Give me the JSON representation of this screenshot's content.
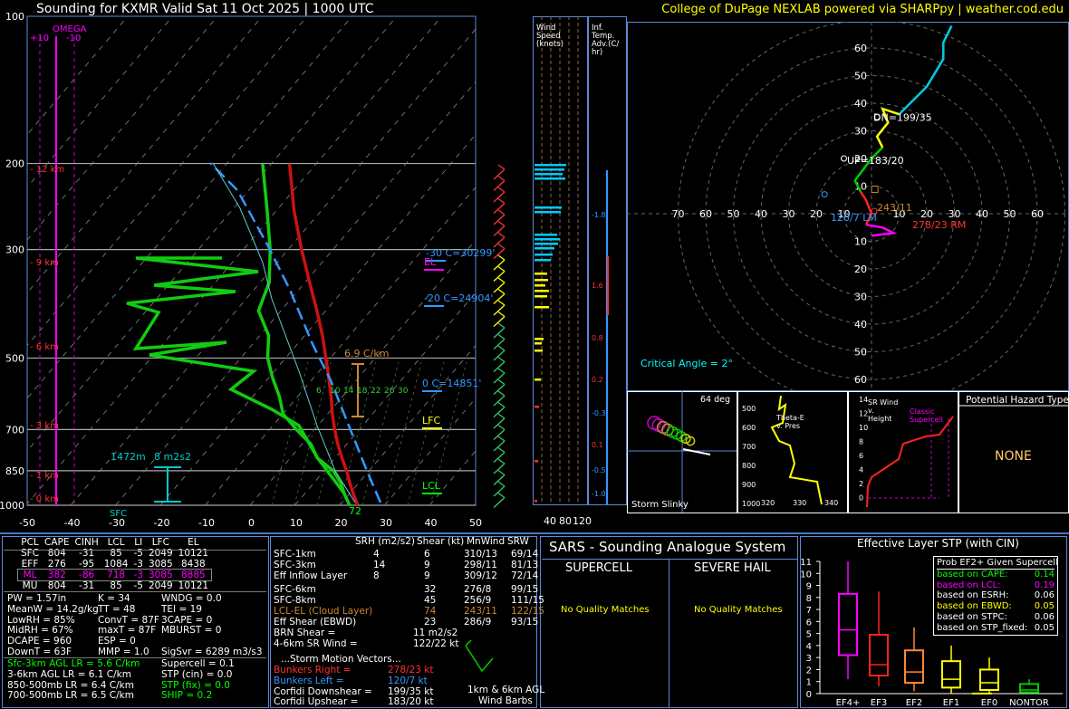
{
  "header": {
    "title": "Sounding for KXMR Valid  Sat 11 Oct 2025 | 1000 UTC",
    "credit": "College of DuPage NEXLAB powered via SHARPpy | weather.cod.edu"
  },
  "skewt": {
    "omega_label": "OMEGA",
    "omega_ticks": [
      "+10",
      "-10"
    ],
    "pressure_ticks": [
      "100",
      "200",
      "300",
      "500",
      "700",
      "850",
      "1000"
    ],
    "temp_ticks": [
      "-50",
      "-40",
      "-30",
      "-20",
      "-10",
      "0",
      "10",
      "20",
      "30",
      "40",
      "50"
    ],
    "height_labels": [
      "12 km",
      "9 km",
      "6 km",
      "3 km",
      "1 km",
      "0 km"
    ],
    "levels": [
      {
        "label": "-30 C=30299'",
        "kind": "iso"
      },
      {
        "label": "EL",
        "kind": "el"
      },
      {
        "label": "-20 C=24904'",
        "kind": "iso"
      },
      {
        "label": "0 C=14851'",
        "kind": "iso"
      },
      {
        "label": "LFC",
        "kind": "lfc"
      },
      {
        "label": "LCL",
        "kind": "lcl"
      }
    ],
    "lapse_label": "6.9 C/km",
    "eff_inflow_label": "1472m",
    "eff_srh_label": "8 m2s2",
    "sfc_label": "SFC",
    "dewpoint_sfc": "72",
    "mixing_ratio_labels": [
      "6",
      "10",
      "14",
      "18",
      "22",
      "26",
      "30"
    ]
  },
  "wind_speed_panel": {
    "title": "Wind Speed (knots)",
    "ticks": [
      "40",
      "80",
      "120"
    ]
  },
  "inferred_adv_panel": {
    "title": "Inf. Temp. Adv.(C/ hr)",
    "labels": [
      "-1.8",
      "1.6",
      "0.8",
      "0.2",
      "-0.3",
      "0.1",
      "-0.5",
      "-1.0"
    ]
  },
  "hodograph": {
    "rings": [
      "10",
      "20",
      "30",
      "40",
      "50",
      "60"
    ],
    "x_ticks": [
      "70",
      "60",
      "50",
      "40",
      "30",
      "20",
      "10",
      "10",
      "20",
      "30",
      "40",
      "50",
      "60"
    ],
    "y_ticks": [
      "60",
      "50",
      "40",
      "30",
      "20",
      "10",
      "10",
      "20",
      "30",
      "40",
      "50",
      "60"
    ],
    "dn_label": "DN=199/35",
    "up_label": "UP=183/20",
    "mean_label": "243/11",
    "lm_label": "120/7 LM",
    "rm_label": "278/23 RM",
    "critical_angle": "Critical Angle = 2°"
  },
  "small_panels": {
    "storm_slinky": {
      "title": "Storm Slinky",
      "deg": "64 deg"
    },
    "theta_e": {
      "title": "Theta-E v. Pres",
      "y_ticks": [
        "500",
        "600",
        "700",
        "800",
        "900",
        "1000"
      ],
      "x_ticks": [
        "320",
        "330",
        "340"
      ]
    },
    "sr_wind": {
      "title": "SR Wind v. Height",
      "y_ticks": [
        "14",
        "12",
        "10",
        "8",
        "6",
        "4",
        "2",
        "0"
      ],
      "label": "Classic Supercell"
    },
    "hazard": {
      "title": "Potential Hazard Type",
      "value": "NONE"
    }
  },
  "parcels": {
    "headers": [
      "PCL",
      "CAPE",
      "CINH",
      "LCL",
      "LI",
      "LFC",
      "EL"
    ],
    "rows": [
      [
        "SFC",
        "804",
        "-31",
        "85",
        "-5",
        "2049",
        "10121"
      ],
      [
        "EFF",
        "276",
        "-95",
        "1084",
        "-3",
        "3085",
        "8438"
      ],
      [
        "ML",
        "382",
        "-86",
        "718",
        "-3",
        "3085",
        "8885"
      ],
      [
        "MU",
        "804",
        "-31",
        "85",
        "-5",
        "2049",
        "10121"
      ]
    ]
  },
  "thermo": {
    "col1": [
      "PW = 1.57in",
      "MeanW = 14.2g/kg",
      "LowRH = 85%",
      "MidRH = 67%",
      "DCAPE = 960",
      "DownT = 63F"
    ],
    "col2": [
      "K = 34",
      "TT = 48",
      "ConvT = 87F",
      "maxT = 87F",
      "ESP = 0",
      "MMP = 1.0"
    ],
    "col3": [
      "WNDG = 0.0",
      "TEI = 19",
      "3CAPE = 0",
      "MBURST = 0",
      "",
      "SigSvr = 6289 m3/s3"
    ]
  },
  "lapse_rates": [
    {
      "text": "Sfc-3km AGL LR = 5.6 C/km",
      "color": "#00ff00"
    },
    {
      "text": "3-6km AGL LR = 6.1 C/km",
      "color": "#ffffff"
    },
    {
      "text": "850-500mb LR = 6.4 C/km",
      "color": "#ffffff"
    },
    {
      "text": "700-500mb LR = 6.5 C/km",
      "color": "#ffffff"
    }
  ],
  "indices": [
    {
      "text": "Supercell = 0.1",
      "color": "#ffffff"
    },
    {
      "text": "STP (cin) = 0.0",
      "color": "#ffffff"
    },
    {
      "text": "STP (fix) = 0.0",
      "color": "#00ff00"
    },
    {
      "text": "SHIP = 0.2",
      "color": "#00ff00"
    }
  ],
  "kinematics": {
    "headers": [
      "SRH (m2/s2)",
      "Shear (kt)",
      "MnWind",
      "SRW"
    ],
    "rows1": [
      [
        "SFC-1km",
        "4",
        "6",
        "310/13",
        "69/14"
      ],
      [
        "SFC-3km",
        "14",
        "9",
        "298/11",
        "81/13"
      ],
      [
        "Eff Inflow Layer",
        "8",
        "9",
        "309/12",
        "72/14"
      ]
    ],
    "rows2": [
      [
        "SFC-6km",
        "",
        "32",
        "276/8",
        "99/15"
      ],
      [
        "SFC-8km",
        "",
        "45",
        "256/9",
        "111/15"
      ],
      [
        "LCL-EL (Cloud Layer)",
        "",
        "74",
        "243/11",
        "122/15"
      ],
      [
        "Eff Shear (EBWD)",
        "",
        "23",
        "286/9",
        "93/15"
      ]
    ],
    "brn_shear": "BRN Shear =",
    "brn_value": "11 m2/s2",
    "sr_wind_46": "4-6km SR Wind =",
    "sr_wind_46_value": "122/22 kt",
    "storm_motion_title": "...Storm Motion Vectors...",
    "vectors": [
      {
        "label": "Bunkers Right =",
        "value": "278/23 kt",
        "color": "#ff3030"
      },
      {
        "label": "Bunkers Left =",
        "value": "120/7 kt",
        "color": "#3399ff"
      },
      {
        "label": "Corfidi Downshear =",
        "value": "199/35 kt",
        "color": "#ffffff"
      },
      {
        "label": "Corfidi Upshear =",
        "value": "183/20 kt",
        "color": "#ffffff"
      }
    ],
    "barbs_label1": "1km & 6km AGL",
    "barbs_label2": "Wind Barbs"
  },
  "sars": {
    "title": "SARS - Sounding Analogue System",
    "supercell_title": "SUPERCELL",
    "hail_title": "SEVERE HAIL",
    "supercell_result": "No Quality Matches",
    "hail_result": "No Quality Matches"
  },
  "stp": {
    "title": "Effective Layer STP (with CIN)",
    "y_ticks": [
      "11",
      "10",
      "9",
      "8",
      "7",
      "6",
      "5",
      "4",
      "3",
      "2",
      "1",
      "0"
    ],
    "x_labels": [
      "EF4+",
      "EF3",
      "EF2",
      "EF1",
      "EF0",
      "NONTOR"
    ],
    "legend_title": "Prob EF2+ Given Supercell",
    "legend": [
      {
        "label": "based on CAPE:",
        "value": "0.14",
        "color": "#00ff00"
      },
      {
        "label": "based on LCL:",
        "value": "0.19",
        "color": "#ff00ff"
      },
      {
        "label": "based on ESRH:",
        "value": "0.06",
        "color": "#ffffff"
      },
      {
        "label": "based on EBWD:",
        "value": "0.05",
        "color": "#ffff00"
      },
      {
        "label": "based on STPC:",
        "value": "0.06",
        "color": "#ffffff"
      },
      {
        "label": "based on STP_fixed:",
        "value": "0.05",
        "color": "#ffffff"
      }
    ]
  },
  "chart_data": {
    "type": "line",
    "title": "Sounding for KXMR Valid  Sat 11 Oct 2025 | 1000 UTC",
    "xlabel": "",
    "ylabel": "",
    "xlim": [
      -50,
      50
    ],
    "ylim": [
      1000,
      100
    ],
    "y_scale": "log",
    "series": [
      {
        "name": "",
        "points": [
          [
            1000,
            24
          ],
          [
            950,
            21
          ],
          [
            900,
            18
          ],
          [
            850,
            15
          ],
          [
            800,
            11.5
          ],
          [
            750,
            8
          ],
          [
            700,
            4.5
          ],
          [
            650,
            1
          ],
          [
            600,
            -2.5
          ],
          [
            550,
            -6.5
          ],
          [
            500,
            -11
          ],
          [
            450,
            -16
          ],
          [
            400,
            -22
          ],
          [
            350,
            -29
          ],
          [
            300,
            -37
          ],
          [
            250,
            -46
          ],
          [
            200,
            -56
          ]
        ]
      },
      {
        "name": "",
        "points": [
          [
            1000,
            22.2
          ],
          [
            950,
            19
          ],
          [
            900,
            16
          ],
          [
            850,
            12
          ],
          [
            800,
            6
          ],
          [
            750,
            2
          ],
          [
            700,
            -4
          ],
          [
            650,
            -10
          ],
          [
            600,
            -14
          ],
          [
            550,
            -19
          ],
          [
            500,
            -24
          ],
          [
            450,
            -28
          ],
          [
            400,
            -35
          ],
          [
            350,
            -38
          ],
          [
            300,
            -44
          ],
          [
            250,
            -52
          ],
          [
            200,
            -62
          ]
        ]
      }
    ],
    "srh_bars": {
      "x_labels": [
        "EF4+",
        "EF3",
        "EF2",
        "EF1",
        "EF0",
        "NONTOR"
      ],
      "medians": [
        5.3,
        2.4,
        1.8,
        1.2,
        0.9,
        0.3
      ],
      "q1": [
        3.2,
        1.5,
        0.9,
        0.5,
        0.3,
        0.1
      ],
      "q3": [
        8.3,
        4.9,
        3.6,
        2.7,
        2.0,
        0.8
      ],
      "whisker_low": [
        1.2,
        0.6,
        0.2,
        0.0,
        0.0,
        0.0
      ],
      "whisker_high": [
        11.0,
        8.5,
        5.5,
        4.0,
        3.0,
        1.2
      ],
      "ylim": [
        0,
        11
      ]
    }
  }
}
